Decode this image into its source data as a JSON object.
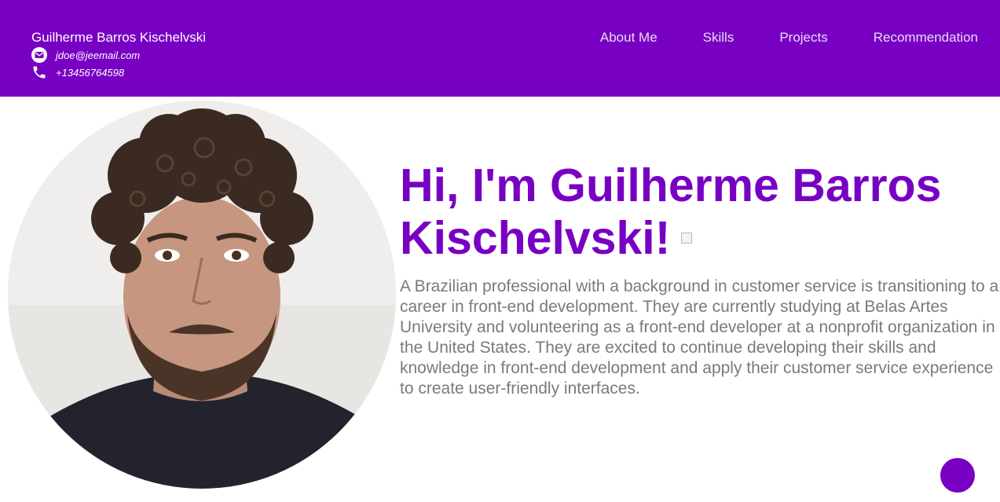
{
  "header": {
    "name": "Guilherme Barros Kischelvski",
    "email": "jdoe@jeemail.com",
    "phone": "+13456764598",
    "email_icon": "envelope-icon",
    "phone_icon": "phone-icon",
    "background_color": "#7800c2"
  },
  "nav": {
    "items": [
      "About Me",
      "Skills",
      "Projects",
      "Recommendation"
    ]
  },
  "hero": {
    "title": "Hi, I'm Guilherme Barros Kischelvski!",
    "description": "A Brazilian professional with a background in customer service is transitioning to a career in front-end development. They are currently studying at Belas Artes University and volunteering as a front-end developer at a nonprofit organization in the United States. They are excited to continue developing their skills and knowledge in front-end development and apply their customer service experience to create user-friendly interfaces.",
    "title_color": "#7800c2",
    "text_color": "#7a7a7a"
  },
  "fab": {
    "color": "#7800c2"
  }
}
